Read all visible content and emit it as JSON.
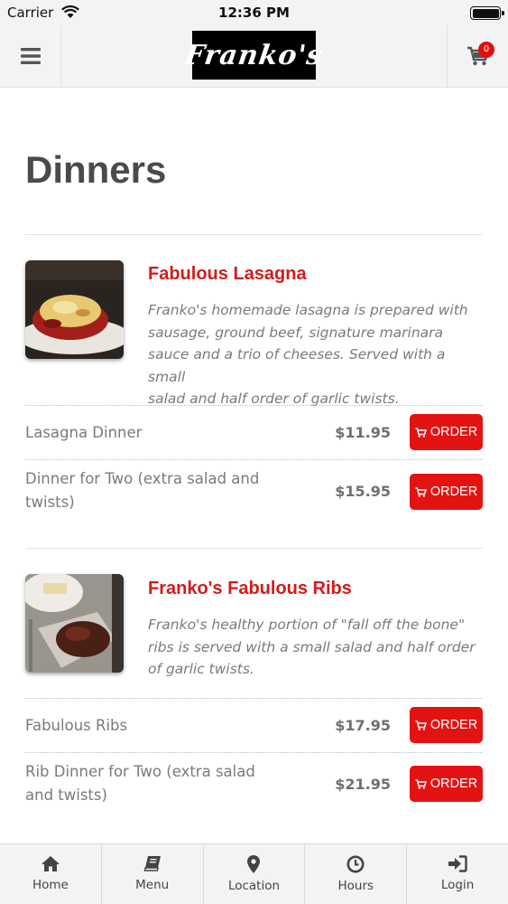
{
  "status_bar": {
    "carrier": "Carrier",
    "time": "12:36 PM"
  },
  "header": {
    "logo_text": "Franko's",
    "cart_count": "0"
  },
  "page": {
    "title": "Dinners"
  },
  "menu_items": [
    {
      "name": "Fabulous Lasagna",
      "description_lines": [
        "Franko's homemade lasagna is prepared with",
        "sausage, ground beef, signature marinara",
        "sauce and a trio of cheeses. Served with a small",
        "salad and half order of garlic twists."
      ],
      "image_icon": "lasagna-photo",
      "options": [
        {
          "label_lines": [
            "Lasagna Dinner"
          ],
          "price": "$11.95",
          "button": "ORDER"
        },
        {
          "label_lines": [
            "Dinner for Two (extra salad and",
            "twists)"
          ],
          "price": "$15.95",
          "button": "ORDER"
        }
      ]
    },
    {
      "name": "Franko's Fabulous Ribs",
      "description_lines": [
        "Franko's healthy portion of \"fall off the bone\"",
        "ribs is served with a small salad and half order",
        "of garlic twists."
      ],
      "image_icon": "ribs-photo",
      "options": [
        {
          "label_lines": [
            "Fabulous Ribs"
          ],
          "price": "$17.95",
          "button": "ORDER"
        },
        {
          "label_lines": [
            "Rib Dinner for Two (extra salad",
            "and twists)"
          ],
          "price": "$21.95",
          "button": "ORDER"
        }
      ]
    }
  ],
  "bottom_nav": [
    {
      "label": "Home",
      "icon": "home-icon"
    },
    {
      "label": "Menu",
      "icon": "book-icon"
    },
    {
      "label": "Location",
      "icon": "map-pin-icon"
    },
    {
      "label": "Hours",
      "icon": "clock-icon"
    },
    {
      "label": "Login",
      "icon": "sign-in-icon"
    }
  ],
  "colors": {
    "accent": "#e41313",
    "item_title": "#d61a1a",
    "header_bg": "#f3f3f3"
  }
}
